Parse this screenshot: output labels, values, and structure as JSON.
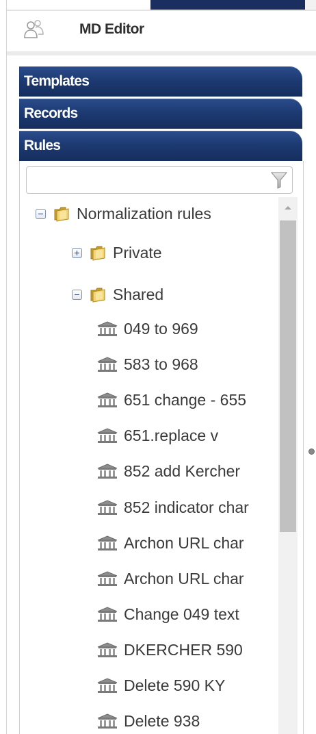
{
  "header": {
    "title": "MD Editor",
    "icon": "users-icon"
  },
  "accordion": {
    "sections": [
      {
        "label": "Templates"
      },
      {
        "label": "Records"
      },
      {
        "label": "Rules"
      }
    ]
  },
  "filter": {
    "value": "",
    "placeholder": "",
    "icon": "filter-icon"
  },
  "tree": {
    "root": {
      "label": "Normalization rules",
      "expanded": true
    },
    "private": {
      "label": "Private",
      "expanded": false
    },
    "shared": {
      "label": "Shared",
      "expanded": true
    },
    "rules": [
      {
        "label": "049 to 969"
      },
      {
        "label": "583 to 968"
      },
      {
        "label": "651 change - 655"
      },
      {
        "label": "651.replace v"
      },
      {
        "label": "852 add Kercher"
      },
      {
        "label": "852 indicator char"
      },
      {
        "label": "Archon URL char"
      },
      {
        "label": "Archon URL char"
      },
      {
        "label": "Change 049 text"
      },
      {
        "label": "DKERCHER 590"
      },
      {
        "label": "Delete 590 KY"
      },
      {
        "label": "Delete 938"
      }
    ]
  },
  "colors": {
    "accordion_header": "#1d3a72",
    "folder": "#e8c25a",
    "text": "#3a3a3a"
  }
}
